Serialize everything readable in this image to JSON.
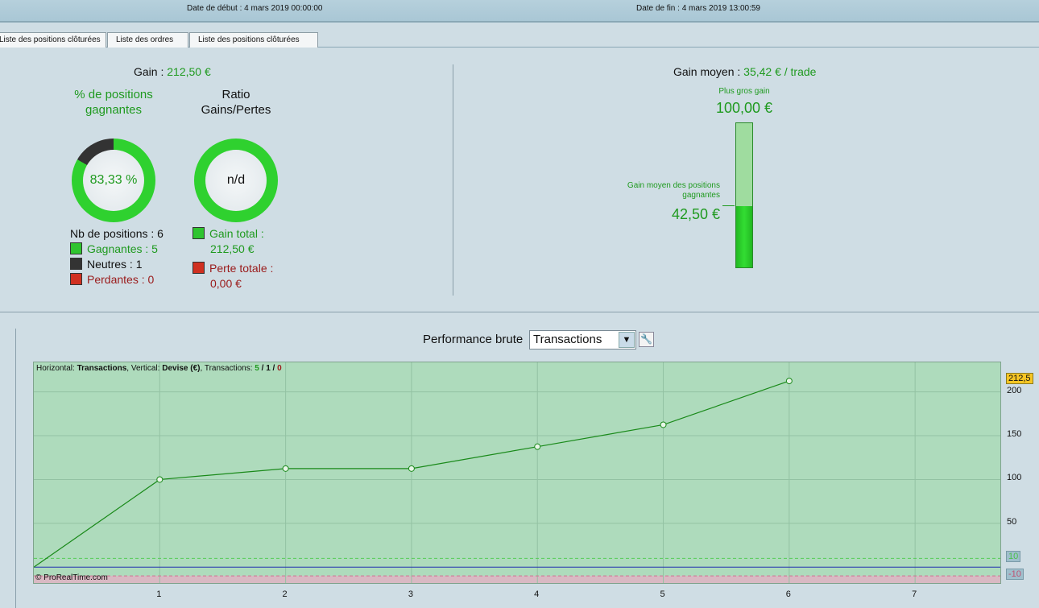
{
  "header": {
    "start_label": "Date de début :",
    "start_value": "4 mars 2019 00:00:00",
    "end_label": "Date de fin :",
    "end_value": "4 mars 2019 13:00:59"
  },
  "tabs": [
    "Liste des positions clôturées",
    "Liste des ordres",
    "Liste des positions clôturées"
  ],
  "summary": {
    "gain_label": "Gain :",
    "gain_value": "212,50 €",
    "pct_title": "% de positions gagnantes",
    "pct_value": "83,33 %",
    "pct_fraction": 0.8333,
    "ratio_title": "Ratio Gains/Pertes",
    "ratio_value": "n/d",
    "nb_positions": "Nb de positions : 6",
    "gagnantes": "Gagnantes : 5",
    "neutres": "Neutres : 1",
    "perdantes": "Perdantes : 0",
    "gain_total_label": "Gain total :",
    "gain_total_value": "212,50 €",
    "perte_totale_label": "Perte totale :",
    "perte_totale_value": "0,00 €"
  },
  "average": {
    "label": "Gain moyen :",
    "value": "35,42 € / trade",
    "max_label": "Plus gros gain",
    "max_value": "100,00 €",
    "avg_win_label": "Gain moyen des positions gagnantes",
    "avg_win_value": "42,50 €",
    "avg_win_fraction": 0.425
  },
  "perf": {
    "title": "Performance brute",
    "select_value": "Transactions"
  },
  "colors": {
    "green": "#1f9a1f",
    "red": "#9a1a1a",
    "plot": "#aedbbc"
  },
  "chart_data": {
    "type": "line",
    "info_prefix": "Horizontal:",
    "info_h": "Transactions",
    "info_mid": ", Vertical:",
    "info_v": "Devise (€)",
    "info_tx": ", Transactions:",
    "info_win": "5",
    "info_neu": "1",
    "info_loss": "0",
    "sep": "/",
    "x": [
      0,
      1,
      2,
      3,
      4,
      5,
      6
    ],
    "y": [
      0,
      100,
      112.5,
      112.5,
      137.5,
      162.5,
      212.5
    ],
    "xlim": [
      0,
      7.69
    ],
    "ylim": [
      -20,
      233.7
    ],
    "xticks": [
      "1",
      "2",
      "3",
      "4",
      "5",
      "6",
      "7"
    ],
    "yticks": [
      "200",
      "150",
      "100",
      "50"
    ],
    "last_value_label": "212,5",
    "upper_band": "10",
    "lower_band": "-10",
    "copyright": "© ProRealTime.com"
  }
}
